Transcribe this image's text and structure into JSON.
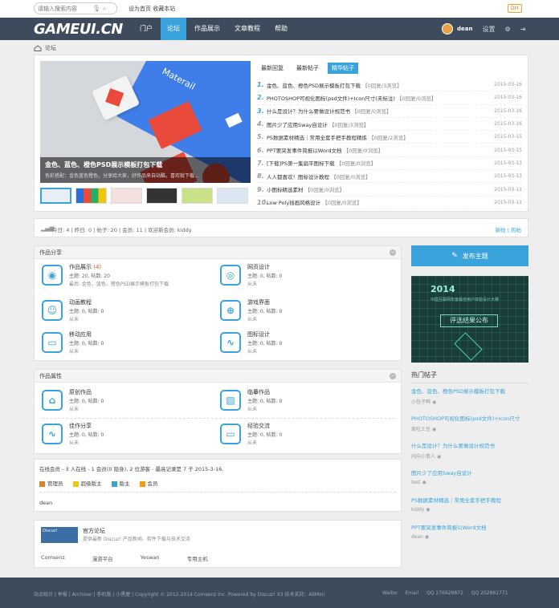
{
  "topbar": {
    "search_placeholder": "请输入搜索内容",
    "top_link": "设为首页 收藏本站",
    "diy_label": "DIY"
  },
  "nav": {
    "logo": "GAMEUI.CN",
    "items": [
      {
        "label": "门户"
      },
      {
        "label": "论坛"
      },
      {
        "label": "作品展示"
      },
      {
        "label": "文章教程"
      },
      {
        "label": "帮助"
      }
    ],
    "username": "dean",
    "settings_label": "设置"
  },
  "breadcrumb": {
    "current": "论坛"
  },
  "slider": {
    "decor_text": "Materail",
    "caption_title": "金色、蓝色、橙色PSD展示模板打包下载",
    "caption_desc": "色彩搭配：金色蓝色橙色，分享给大家，好作品来自站酷，喜欢就下载..."
  },
  "tabs": [
    {
      "label": "最新回复"
    },
    {
      "label": "最新帖子"
    },
    {
      "label": "精华帖子"
    }
  ],
  "news": [
    {
      "num": "1.",
      "title": "金色、蓝色、橙色PSD展示模板打包下载",
      "tag": "【0回复/3浏览】",
      "date": "2015-03-16"
    },
    {
      "num": "2.",
      "title": "PHOTOSHOP可视化图标(psd文件)+Icon尺寸(未标注)",
      "tag": "【0回复/0浏览】",
      "date": "2015-03-16"
    },
    {
      "num": "3.",
      "title": "什么是设计？为什么要做设计规范书",
      "tag": "【0回复/0浏览】",
      "date": "2015-03-16"
    },
    {
      "num": "4.",
      "title": "图片少了应用Sway自设计",
      "tag": "【0回复/3浏览】",
      "date": "2015-03-16"
    },
    {
      "num": "5.",
      "title": "PS数据素材精选｜常用全套手把手教程精炼",
      "tag": "【0回复/2浏览】",
      "date": "2015-03-15"
    },
    {
      "num": "6.",
      "title": "PPT要突发事件简报以Word文档",
      "tag": "【0回复/0浏览】",
      "date": "2015-03-15"
    },
    {
      "num": "7.",
      "title": "[下载]PS第一集扁平图标下载",
      "tag": "【0回复/0浏览】",
      "date": "2015-03-13"
    },
    {
      "num": "8.",
      "title": "人人都喜欢！图标设计教程",
      "tag": "【0回复/0浏览】",
      "date": "2015-03-13"
    },
    {
      "num": "9.",
      "title": "小图标精选素材",
      "tag": "【0回复/0浏览】",
      "date": "2015-03-11"
    },
    {
      "num": "10.",
      "title": "Low Poly插画风格设计",
      "tag": "【0回复/0浏览】",
      "date": "2015-03-11"
    }
  ],
  "stats": {
    "text": "今日: 4 | 昨日: 0 | 帖子: 20 | 会员: 11 | 欢迎新会员: kiddy",
    "right": "新帖 | 热帖"
  },
  "sections": {
    "works_title": "作品分享",
    "attr_title": "作品属性"
  },
  "forums_left": [
    {
      "name": "作品展示",
      "new": "(4)",
      "meta": "主题: 20, 帖数: 20",
      "meta2": "最后: 金色、蓝色、橙色PSD展示模板打包下载",
      "glyph": "◉"
    },
    {
      "name": "动画教程",
      "new": "",
      "meta": "主题: 0, 帖数: 0",
      "meta2": "从未",
      "glyph": "☺"
    },
    {
      "name": "移动应用",
      "new": "",
      "meta": "主题: 0, 帖数: 0",
      "meta2": "从未",
      "glyph": "▭"
    }
  ],
  "forums_right": [
    {
      "name": "网页设计",
      "new": "",
      "meta": "主题: 0, 帖数: 0",
      "meta2": "从未",
      "glyph": "◎"
    },
    {
      "name": "游戏界面",
      "new": "",
      "meta": "主题: 0, 帖数: 0",
      "meta2": "从未",
      "glyph": "⊕"
    },
    {
      "name": "图标设计",
      "new": "",
      "meta": "主题: 0, 帖数: 0",
      "meta2": "从未",
      "glyph": "∿"
    }
  ],
  "attr_left": [
    {
      "name": "原创作品",
      "meta": "主题: 0, 帖数: 0",
      "meta2": "从未",
      "glyph": "⌂"
    },
    {
      "name": "佳作分享",
      "meta": "主题: 0, 帖数: 0",
      "meta2": "从未",
      "glyph": "∿"
    }
  ],
  "attr_right": [
    {
      "name": "临摹作品",
      "meta": "主题: 0, 帖数: 0",
      "meta2": "从未",
      "glyph": "▧"
    },
    {
      "name": "经验交流",
      "meta": "主题: 0, 帖数: 0",
      "meta2": "从未",
      "glyph": "▭"
    }
  ],
  "online": {
    "header": "在线会员 - 3 人在线 - 1 会员(0 隐身), 2 位游客 - 最高记录是 7 于 2015-3-16.",
    "legend": [
      {
        "label": "管理员",
        "color": "#e67e22"
      },
      {
        "label": "超级版主",
        "color": "#f1c40f"
      },
      {
        "label": "版主",
        "color": "#3ba3dc"
      },
      {
        "label": "会员",
        "color": "#f39c12"
      }
    ],
    "user": "dean"
  },
  "links": {
    "badge": "Discuz!",
    "title": "官方论坛",
    "desc": "提供最新 Discuz! 产品新闻、软件下载与技术交流",
    "items": [
      "Comsenz",
      "漫游平台",
      "Yeswan",
      "专用主机"
    ]
  },
  "sidebar": {
    "post_button": "发布主题",
    "ad_year": "2014",
    "ad_sub": "中国互联网年度最佳用户体验设计大赛",
    "ad_button": "评选结果公布",
    "hot_title": "热门帖子",
    "hot": [
      {
        "title": "金色、蓝色、橙色PSD展示模板打包下载",
        "meta": "小包子鸭"
      },
      {
        "title": "PHOTOSHOP可视化图标(psd文件)+Icon尺寸",
        "meta": "爱吃土豆"
      },
      {
        "title": "什么是设计？为什么要做设计规范书",
        "meta": "内向小青人"
      },
      {
        "title": "图片少了应用Sway自设计",
        "meta": "test"
      },
      {
        "title": "PS数据素材精选｜常用全套手把手教程",
        "meta": "kiddy"
      },
      {
        "title": "PPT要突发事件简报以Word文档",
        "meta": "dean"
      }
    ]
  },
  "footer": {
    "left": "站点统计 | 举报 | Archiver | 手机版 | 小黑屋 | Copyright © 2012-2014 Comsenz Inc. Powered by Discuz! X3 技术支持：AllMini",
    "right": [
      "Weibo",
      "Email",
      "QQ 276928872",
      "QQ 202881771"
    ]
  }
}
